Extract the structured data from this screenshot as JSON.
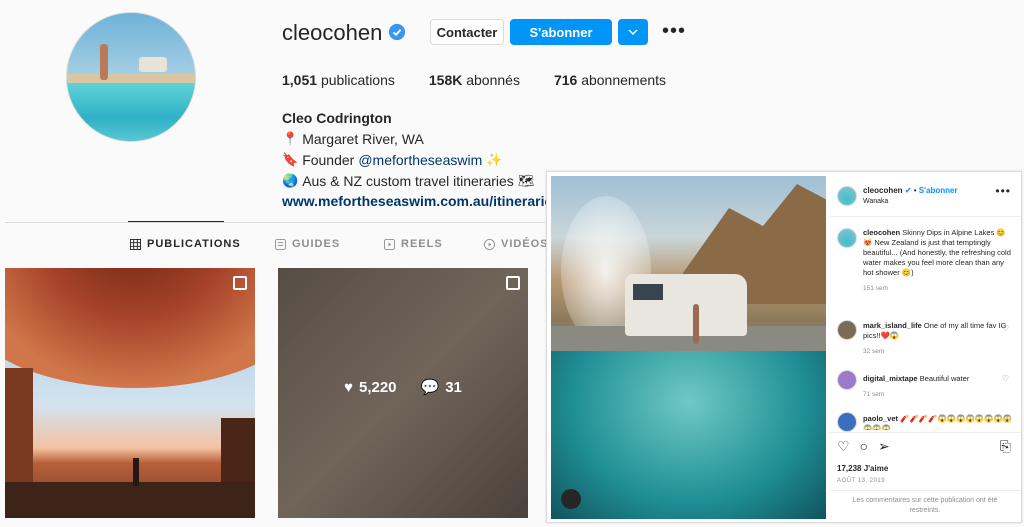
{
  "profile": {
    "username": "cleocohen",
    "contact_label": "Contacter",
    "follow_label": "S'abonner",
    "stats": {
      "posts_value": "1,051",
      "posts_label": "publications",
      "followers_value": "158K",
      "followers_label": "abonnés",
      "following_value": "716",
      "following_label": "abonnements"
    },
    "full_name": "Cleo Codrington",
    "bio": {
      "line1": "Margaret River, WA",
      "line2_prefix": "Founder",
      "line2_mention": "@mefortheseaswim",
      "line3": "Aus & NZ custom travel itineraries",
      "link": "www.mefortheseaswim.com.au/itineraries"
    }
  },
  "tabs": [
    {
      "label": "PUBLICATIONS",
      "icon": "grid-icon",
      "active": true
    },
    {
      "label": "GUIDES",
      "icon": "guide-icon",
      "active": false
    },
    {
      "label": "REELS",
      "icon": "reels-icon",
      "active": false
    },
    {
      "label": "VIDÉOS",
      "icon": "video-icon",
      "active": false
    }
  ],
  "grid": {
    "tile2_likes": "5,220",
    "tile2_comments": "31"
  },
  "post": {
    "username": "cleocohen",
    "separator": "•",
    "follow_label": "S'abonner",
    "location": "Wanaka",
    "caption_user": "cleocohen",
    "caption_text": "Skinny Dips in Alpine Lakes 😊😻 New Zealand is just that temptingly beautiful... (And honestly, the refreshing cold water makes you feel more clean than any hot shower 😊)",
    "caption_time": "151 sem",
    "comments": [
      {
        "user": "mark_island_life",
        "text": "One of my all time fav IG pics!!❤️😱",
        "time": "32 sem"
      },
      {
        "user": "digital_mixtape",
        "text": "Beautiful water",
        "time": "71 sem"
      },
      {
        "user": "paolo_vet",
        "text": "🧨🧨🧨🧨😱😱😱😱😱😱😱😱😱😱😱",
        "time": ""
      }
    ],
    "likes": "17,238 J'aime",
    "date": "AOÛT 13, 2019",
    "comments_disabled": "Les commentaires sur cette publication ont été restreints."
  },
  "colors": {
    "accent": "#0095f6",
    "verified": "#3897f0",
    "link": "#00376b"
  }
}
